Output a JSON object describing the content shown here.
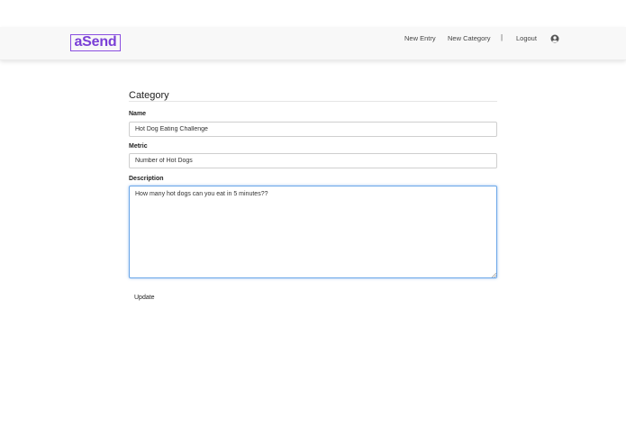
{
  "header": {
    "logo_text": "aSend",
    "nav": {
      "new_entry": "New Entry",
      "new_category": "New Category",
      "separator": "|",
      "logout": "Logout"
    },
    "user_icon": "user-circle-icon"
  },
  "form": {
    "title": "Category",
    "name": {
      "label": "Name",
      "value": "Hot Dog Eating Challenge"
    },
    "metric": {
      "label": "Metric",
      "value": "Number of Hot Dogs"
    },
    "description": {
      "label": "Description",
      "value": "How many hot dogs can you eat in 5 minutes??"
    },
    "submit_label": "Update"
  },
  "colors": {
    "brand": "#7a3fd6",
    "focus_border": "#6aa6e8",
    "navbar_bg": "#f8f8f8"
  }
}
